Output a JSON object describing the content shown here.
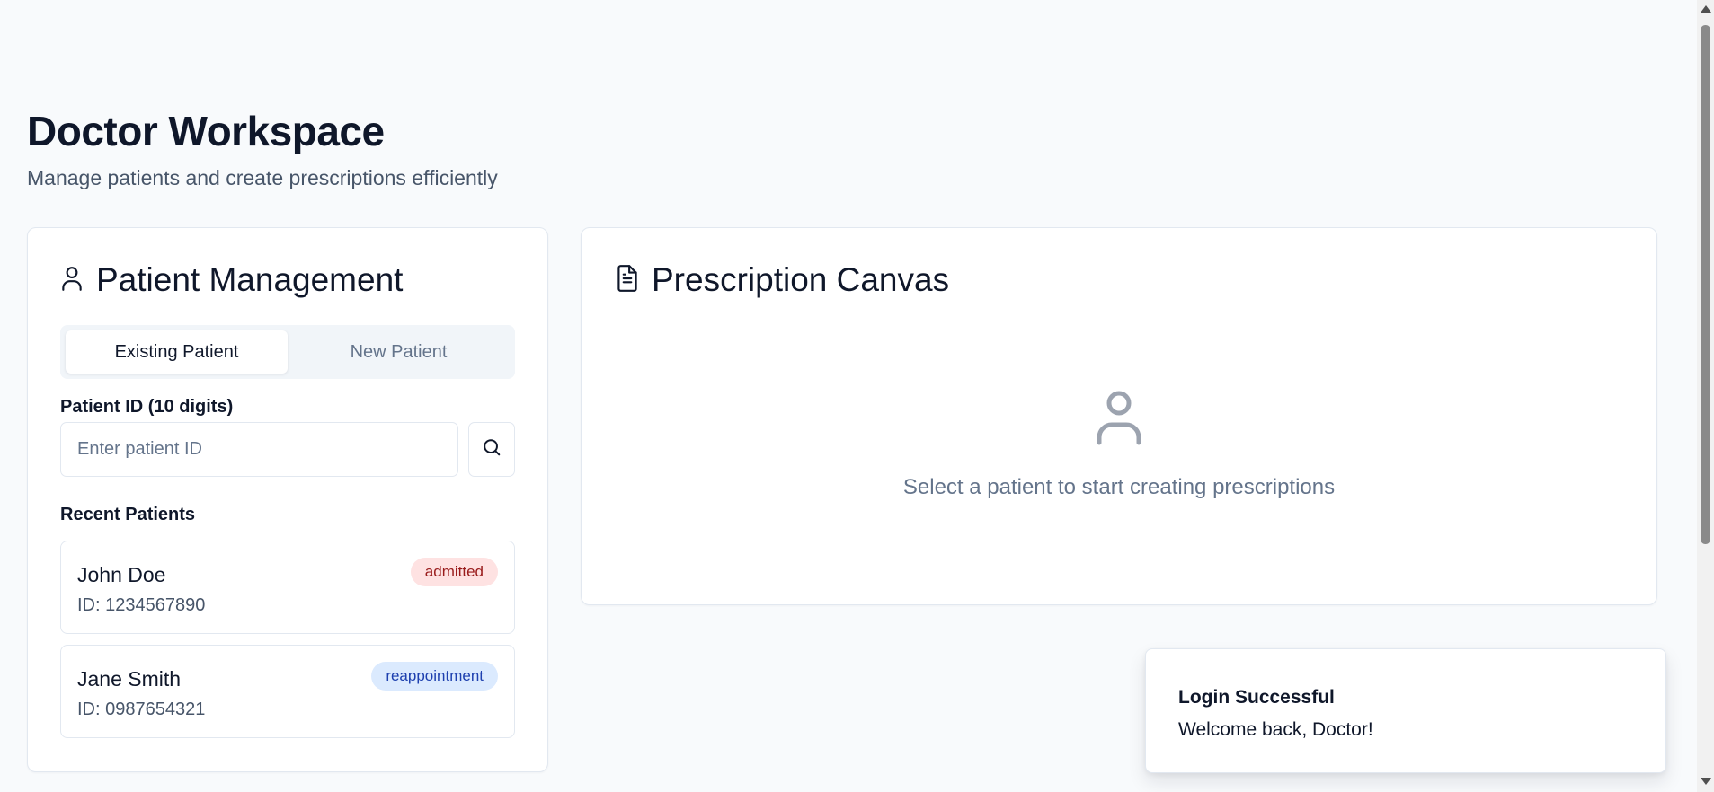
{
  "header": {
    "title": "Doctor Workspace",
    "subtitle": "Manage patients and create prescriptions efficiently"
  },
  "patient_management": {
    "icon": "user-icon",
    "title": "Patient Management",
    "tabs": [
      {
        "label": "Existing Patient",
        "active": true
      },
      {
        "label": "New Patient",
        "active": false
      }
    ],
    "patient_id_label": "Patient ID (10 digits)",
    "patient_id_value": "",
    "patient_id_placeholder": "Enter patient ID",
    "search_icon": "search-icon",
    "recent_label": "Recent Patients",
    "recent_patients": [
      {
        "name": "John Doe",
        "id_text": "ID: 1234567890",
        "status": "admitted"
      },
      {
        "name": "Jane Smith",
        "id_text": "ID: 0987654321",
        "status": "reappointment"
      }
    ]
  },
  "prescription_canvas": {
    "icon": "file-text-icon",
    "title": "Prescription Canvas",
    "empty_icon": "user-icon",
    "empty_message": "Select a patient to start creating prescriptions"
  },
  "toast": {
    "title": "Login Successful",
    "description": "Welcome back, Doctor!"
  },
  "colors": {
    "background": "#f8fafc",
    "admitted_badge_bg": "#fee2e2",
    "admitted_badge_text": "#991b1b",
    "reappointment_badge_bg": "#dbeafe",
    "reappointment_badge_text": "#1e40af"
  }
}
